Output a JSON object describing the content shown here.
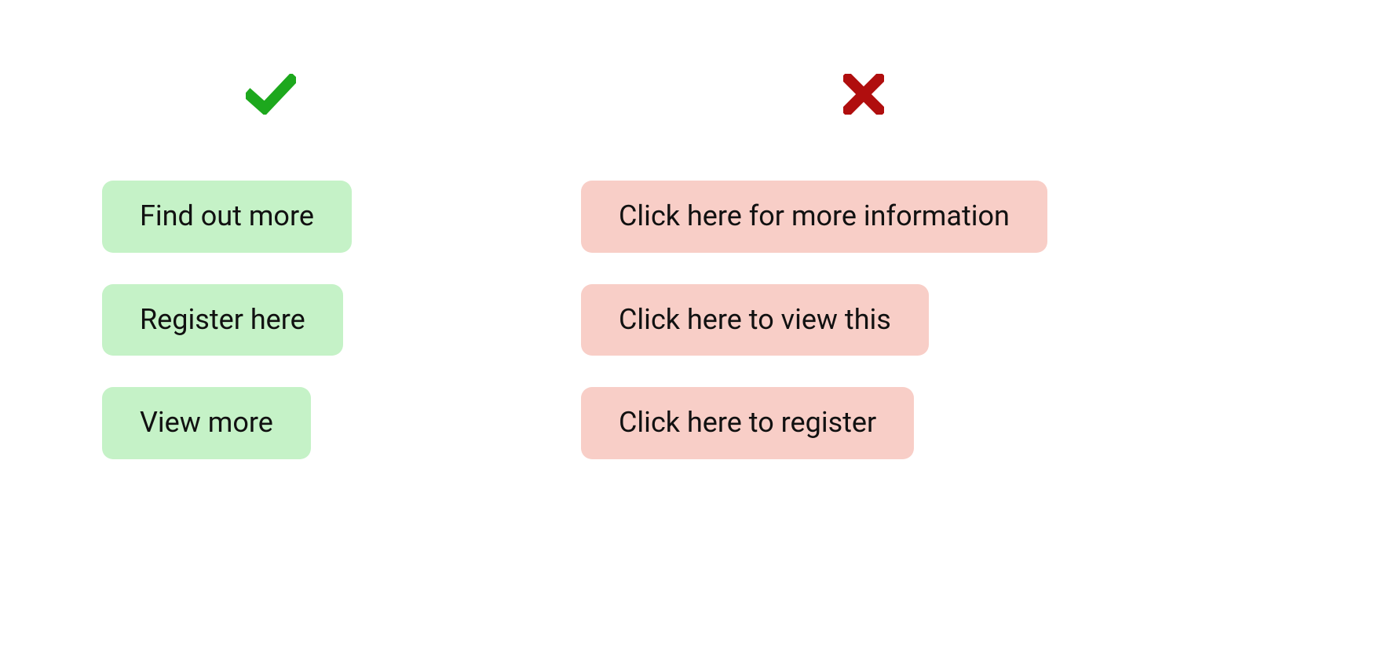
{
  "good": {
    "icon": "check-icon",
    "items": [
      "Find out more",
      "Register here",
      "View more"
    ]
  },
  "bad": {
    "icon": "cross-icon",
    "items": [
      "Click here for more information",
      "Click here to view this",
      "Click here to register"
    ]
  },
  "colors": {
    "good_bg": "#C5F2C7",
    "bad_bg": "#F8CEC7",
    "check": "#1DA81D",
    "cross": "#B00E0E"
  }
}
